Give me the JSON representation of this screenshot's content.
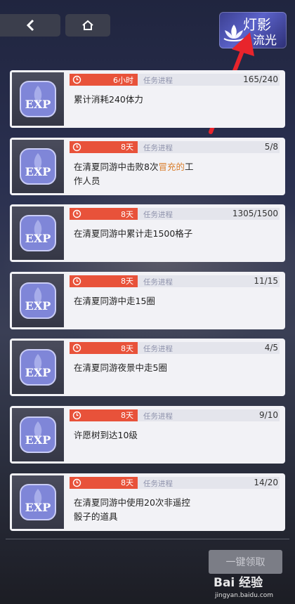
{
  "logo": {
    "line1": "灯影",
    "line2": "流光"
  },
  "tasks": [
    {
      "time": "6小时",
      "label": "任务进程",
      "progress": "165/240",
      "desc": [
        "累计消耗240体力"
      ]
    },
    {
      "time": "8天",
      "label": "任务进程",
      "progress": "5/8",
      "desc_pre": "在清夏同游中击败8次",
      "desc_hl": "冒充的",
      "desc_post": "工",
      "desc_line2": "作人员"
    },
    {
      "time": "8天",
      "label": "任务进程",
      "progress": "1305/1500",
      "desc": [
        "在清夏同游中累计走1500格子"
      ]
    },
    {
      "time": "8天",
      "label": "任务进程",
      "progress": "11/15",
      "desc": [
        "在清夏同游中走15圈"
      ]
    },
    {
      "time": "8天",
      "label": "任务进程",
      "progress": "4/5",
      "desc": [
        "在清夏同游夜景中走5圈"
      ]
    },
    {
      "time": "8天",
      "label": "任务进程",
      "progress": "9/10",
      "desc": [
        "许愿树到达10级"
      ]
    },
    {
      "time": "8天",
      "label": "任务进程",
      "progress": "14/20",
      "desc": [
        "在清夏同游中使用20次非遥控",
        "骰子的道具"
      ]
    }
  ],
  "claim_all": "一键领取",
  "watermark": {
    "title": "Bai 经验",
    "url": "jingyan.baidu.com"
  },
  "colors": {
    "timer": "#e8523a",
    "highlight": "#d97f2e",
    "arrow": "#e8242c"
  }
}
